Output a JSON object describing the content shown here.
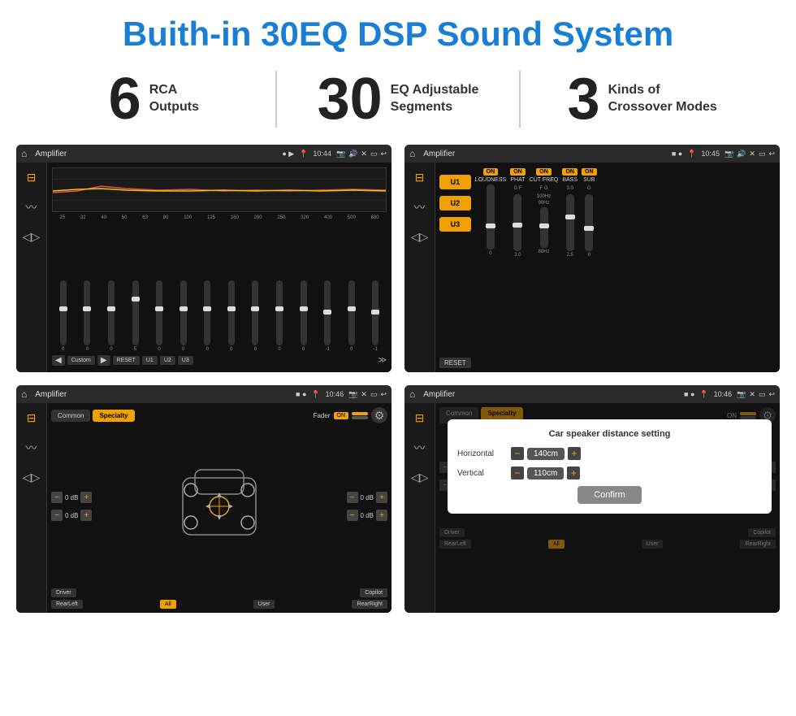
{
  "header": {
    "title": "Buith-in 30EQ DSP Sound System"
  },
  "stats": [
    {
      "number": "6",
      "label": "RCA\nOutputs"
    },
    {
      "number": "30",
      "label": "EQ Adjustable\nSegments"
    },
    {
      "number": "3",
      "label": "Kinds of\nCrossover Modes"
    }
  ],
  "screens": {
    "eq": {
      "title": "Amplifier",
      "time": "10:44",
      "frequencies": [
        "25",
        "32",
        "40",
        "50",
        "63",
        "80",
        "100",
        "125",
        "160",
        "200",
        "250",
        "320",
        "400",
        "500",
        "630"
      ],
      "values": [
        "0",
        "0",
        "0",
        "5",
        "0",
        "0",
        "0",
        "0",
        "0",
        "0",
        "0",
        "-1",
        "0",
        "-1"
      ],
      "buttons": [
        "Custom",
        "RESET",
        "U1",
        "U2",
        "U3"
      ]
    },
    "crossover": {
      "title": "Amplifier",
      "time": "10:45",
      "uButtons": [
        "U1",
        "U2",
        "U3"
      ],
      "controls": [
        "LOUDNESS",
        "PHAT",
        "CUT FREQ",
        "BASS",
        "SUB"
      ],
      "resetLabel": "RESET"
    },
    "speaker": {
      "title": "Amplifier",
      "time": "10:46",
      "tabs": [
        "Common",
        "Specialty"
      ],
      "faderLabel": "Fader",
      "faderOn": "ON",
      "dbValues": [
        "0 dB",
        "0 dB",
        "0 dB",
        "0 dB"
      ],
      "locations": [
        "Driver",
        "Copilot",
        "RearLeft",
        "All",
        "User",
        "RearRight"
      ]
    },
    "distance": {
      "title": "Amplifier",
      "time": "10:46",
      "tabs": [
        "Common",
        "Specialty"
      ],
      "dialogTitle": "Car speaker distance setting",
      "horizontal": {
        "label": "Horizontal",
        "value": "140cm"
      },
      "vertical": {
        "label": "Vertical",
        "value": "110cm"
      },
      "confirmLabel": "Confirm",
      "locations": [
        "Driver",
        "Copilot",
        "RearLeft",
        "All",
        "User",
        "RearRight"
      ]
    }
  }
}
